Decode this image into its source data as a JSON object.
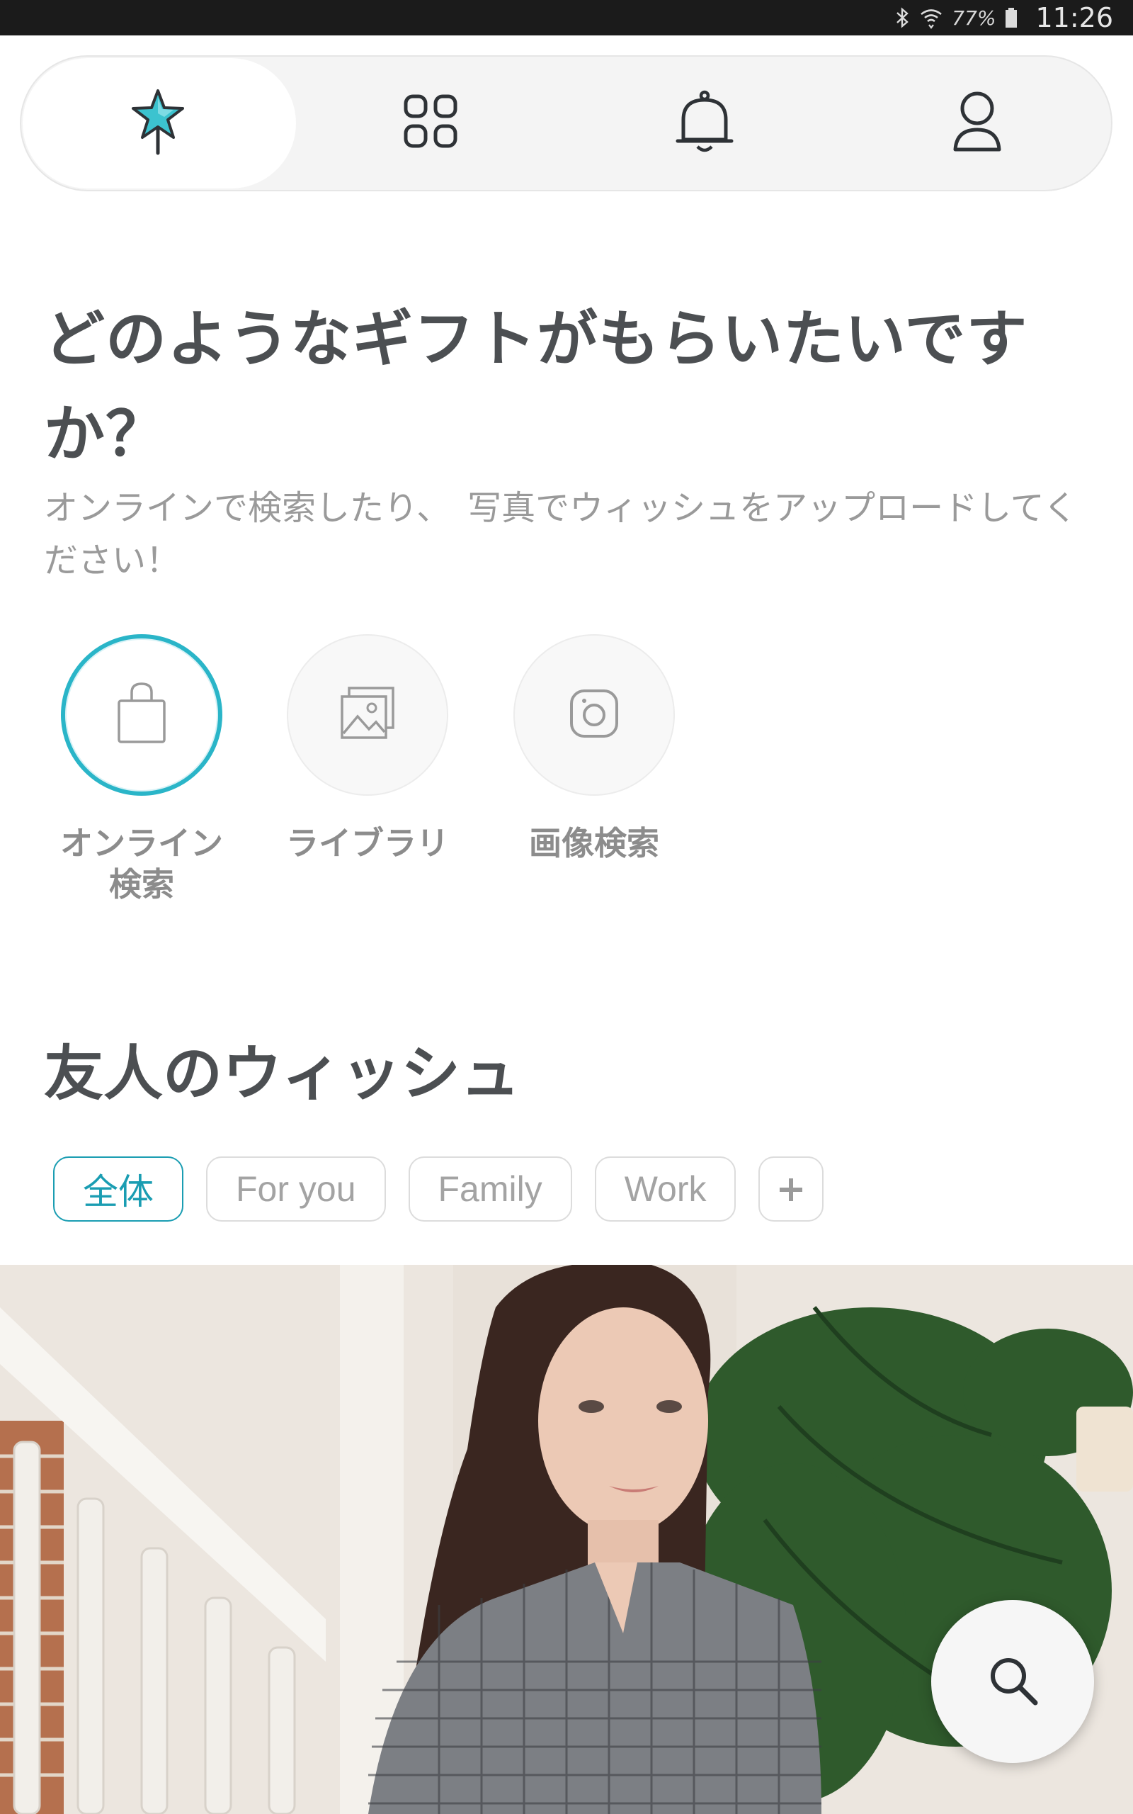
{
  "status_bar": {
    "battery_percent": "77%",
    "time": "11:26",
    "icons": [
      "bluetooth-icon",
      "wifi-icon",
      "battery-icon"
    ]
  },
  "top_nav": {
    "items": [
      {
        "name": "wishlist",
        "icon": "star-wand-icon",
        "active": true
      },
      {
        "name": "apps",
        "icon": "grid-icon",
        "active": false
      },
      {
        "name": "notifications",
        "icon": "bell-icon",
        "active": false
      },
      {
        "name": "profile",
        "icon": "person-icon",
        "active": false
      }
    ]
  },
  "main": {
    "headline": "どのようなギフトがもらいたいですか？",
    "subtitle": "オンラインで検索したり、　写真でウィッシュをアップロードしてください！",
    "actions": [
      {
        "label": "オンライン\n検索",
        "icon": "shopping-bag-icon",
        "active": true
      },
      {
        "label": "ライブラリ",
        "icon": "gallery-icon",
        "active": false
      },
      {
        "label": "画像検索",
        "icon": "camera-icon",
        "active": false
      }
    ]
  },
  "friends": {
    "title": "友人のウィッシュ",
    "filters": [
      "全体",
      "For you",
      "Family",
      "Work"
    ],
    "add_label": "+"
  },
  "colors": {
    "accent": "#1a9db2",
    "accent_light": "#2ab5c8",
    "status_bar": "#1b1b1b",
    "text_dark": "#4c4f52",
    "text_muted": "#9a9a9a"
  }
}
